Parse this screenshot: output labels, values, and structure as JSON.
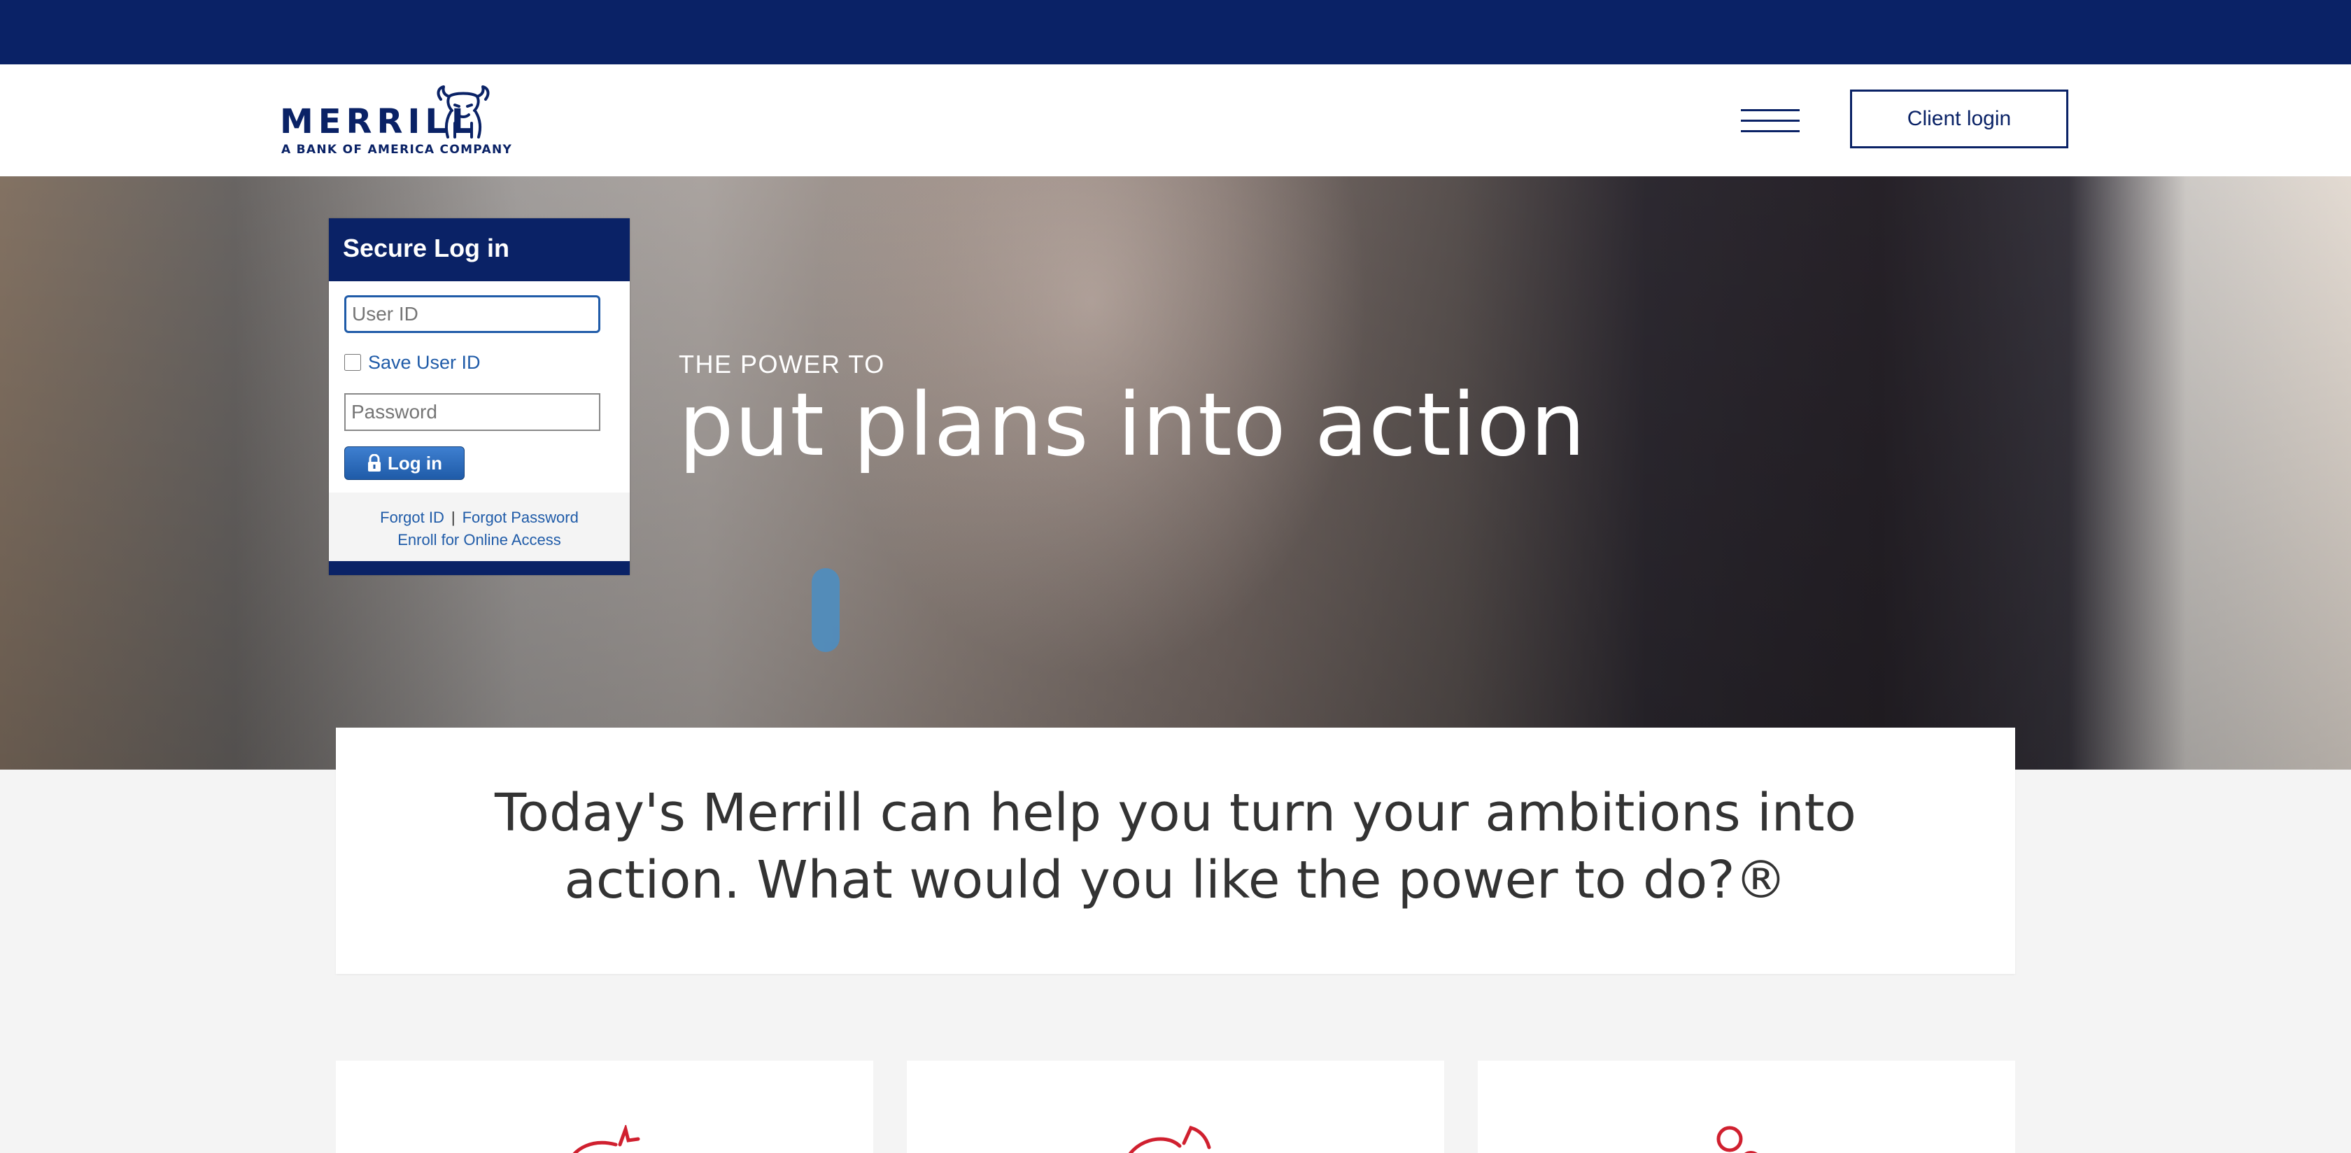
{
  "brand": {
    "logo_word": "MERRILL",
    "logo_tagline": "A BANK OF AMERICA COMPANY",
    "primary_color": "#0a2266",
    "accent_red": "#d0202f",
    "link_blue": "#1f5ba8"
  },
  "header": {
    "menu_icon": "hamburger-menu-icon",
    "client_login_label": "Client login"
  },
  "login": {
    "title": "Secure Log in",
    "user_id_placeholder": "User ID",
    "save_user_id_label": "Save User ID",
    "save_user_id_checked": false,
    "password_placeholder": "Password",
    "login_button_label": "Log in",
    "lock_icon": "lock-icon",
    "forgot_id_label": "Forgot ID",
    "separator": "|",
    "forgot_password_label": "Forgot Password",
    "enroll_label": "Enroll for Online Access"
  },
  "hero": {
    "eyebrow": "THE POWER TO",
    "headline": "put plans into action"
  },
  "intro": {
    "text": "Today's Merrill can help you turn your ambitions into action. What would you like the power to do?®"
  },
  "feature_tiles": [
    {
      "icon": "piggy-bank-icon"
    },
    {
      "icon": "pie-chart-icon"
    },
    {
      "icon": "people-icon"
    }
  ]
}
